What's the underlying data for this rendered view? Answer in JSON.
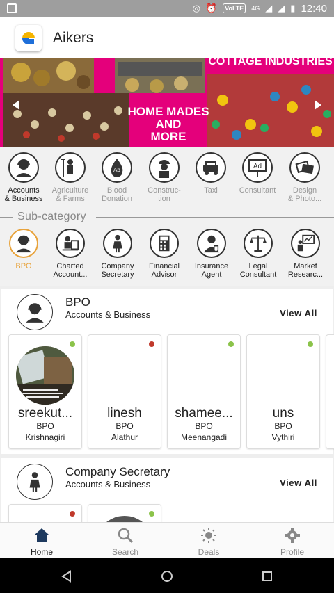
{
  "status_bar": {
    "time": "12:40",
    "volte": "VoLTE",
    "network": "4G"
  },
  "app": {
    "title": "Aikers"
  },
  "banner": {
    "text_right": "COTTAGE INDUSTRIES",
    "text_center_line1": "HOME MADES",
    "text_center_line2": "AND",
    "text_center_line3": "MORE"
  },
  "categories": [
    {
      "line1": "Accounts",
      "line2": "& Business",
      "icon": "headset-icon",
      "active": true
    },
    {
      "line1": "Agriculture",
      "line2": "& Farms",
      "icon": "farmer-icon"
    },
    {
      "line1": "Blood",
      "line2": "Donation",
      "icon": "blood-drop-icon",
      "badge": "Ab"
    },
    {
      "line1": "Construc-",
      "line2": "tion",
      "icon": "worker-icon"
    },
    {
      "line1": "Taxi",
      "line2": "",
      "icon": "taxi-icon"
    },
    {
      "line1": "Consultant",
      "line2": "",
      "icon": "billboard-icon",
      "badge": "Ad"
    },
    {
      "line1": "Design",
      "line2": "& Photo...",
      "icon": "photos-icon"
    }
  ],
  "subcategory_title": "Sub-category",
  "subcategories": [
    {
      "line1": "BPO",
      "line2": "",
      "icon": "headset-icon",
      "active": true
    },
    {
      "line1": "Charted",
      "line2": "Account...",
      "icon": "accountant-icon"
    },
    {
      "line1": "Company",
      "line2": "Secretary",
      "icon": "secretary-icon"
    },
    {
      "line1": "Financial",
      "line2": "Advisor",
      "icon": "calculator-icon"
    },
    {
      "line1": "Insurance",
      "line2": "Agent",
      "icon": "agent-icon"
    },
    {
      "line1": "Legal",
      "line2": "Consultant",
      "icon": "scales-icon"
    },
    {
      "line1": "Market",
      "line2": "Researc...",
      "icon": "presentation-icon"
    }
  ],
  "sections": [
    {
      "title": "BPO",
      "subtitle": "Accounts & Business",
      "view_all": "View All",
      "cards": [
        {
          "name": "sreekut...",
          "category": "BPO",
          "location": "Krishnagiri",
          "status_color": "#8bc34a",
          "has_photo": true
        },
        {
          "name": "linesh",
          "category": "BPO",
          "location": "Alathur",
          "status_color": "#c0392b"
        },
        {
          "name": "shamee...",
          "category": "BPO",
          "location": "Meenangadi",
          "status_color": "#8bc34a"
        },
        {
          "name": "uns",
          "category": "BPO",
          "location": "Vythiri",
          "status_color": "#8bc34a"
        }
      ]
    },
    {
      "title": "Company Secretary",
      "subtitle": "Accounts & Business",
      "view_all": "View All",
      "cards": [
        {
          "status_color": "#c0392b"
        },
        {
          "status_color": "#8bc34a"
        }
      ]
    }
  ],
  "bottom_nav": [
    {
      "label": "Home",
      "icon": "home-icon",
      "active": true
    },
    {
      "label": "Search",
      "icon": "search-icon"
    },
    {
      "label": "Deals",
      "icon": "deals-icon"
    },
    {
      "label": "Profile",
      "icon": "gear-icon"
    }
  ],
  "colors": {
    "accent": "#e8a33c",
    "banner_pink": "#e4007b",
    "online": "#8bc34a",
    "offline": "#c0392b"
  }
}
